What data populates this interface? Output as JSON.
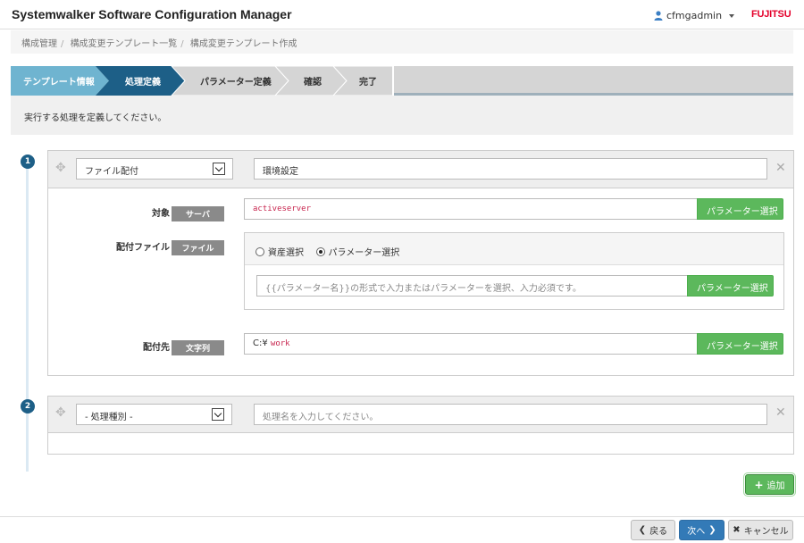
{
  "header": {
    "app_title": "Systemwalker Software Configuration Manager",
    "user_name": "cfmgadmin",
    "logo_text": "FUJITSU"
  },
  "breadcrumb": [
    "構成管理",
    "構成変更テンプレート一覧",
    "構成変更テンプレート作成"
  ],
  "steps": [
    {
      "label": "テンプレート情報",
      "state": "done"
    },
    {
      "label": "処理定義",
      "state": "active"
    },
    {
      "label": "パラメーター定義",
      "state": "pending"
    },
    {
      "label": "確認",
      "state": "pending"
    },
    {
      "label": "完了",
      "state": "pending"
    }
  ],
  "description": "実行する処理を定義してください。",
  "processes": [
    {
      "number": "1",
      "type_value": "ファイル配付",
      "name_value": "環境設定",
      "fields": {
        "target": {
          "label": "対象",
          "tag": "サーバ",
          "value": "activeserver",
          "button": "パラメーター選択"
        },
        "dist_file": {
          "label": "配付ファイル",
          "tag": "ファイル",
          "radio_asset": "資産選択",
          "radio_param": "パラメーター選択",
          "selected": "radio_param",
          "placeholder": "{{パラメーター名}}の形式で入力またはパラメーターを選択、入力必須です。",
          "button": "パラメーター選択"
        },
        "dest": {
          "label": "配付先",
          "tag": "文字列",
          "value_prefix": "C:¥",
          "value_code": "work",
          "button": "パラメーター選択"
        }
      }
    },
    {
      "number": "2",
      "type_value": "- 処理種別 -",
      "name_placeholder": "処理名を入力してください。"
    }
  ],
  "add_button": "追加",
  "footer": {
    "back": "戻る",
    "next": "次へ",
    "cancel": "キャンセル"
  },
  "colors": {
    "step_done": "#6fb4d0",
    "step_active": "#1d5f87",
    "step_pending": "#d5d5d5",
    "green": "#5cb85c",
    "primary": "#337ab7"
  }
}
